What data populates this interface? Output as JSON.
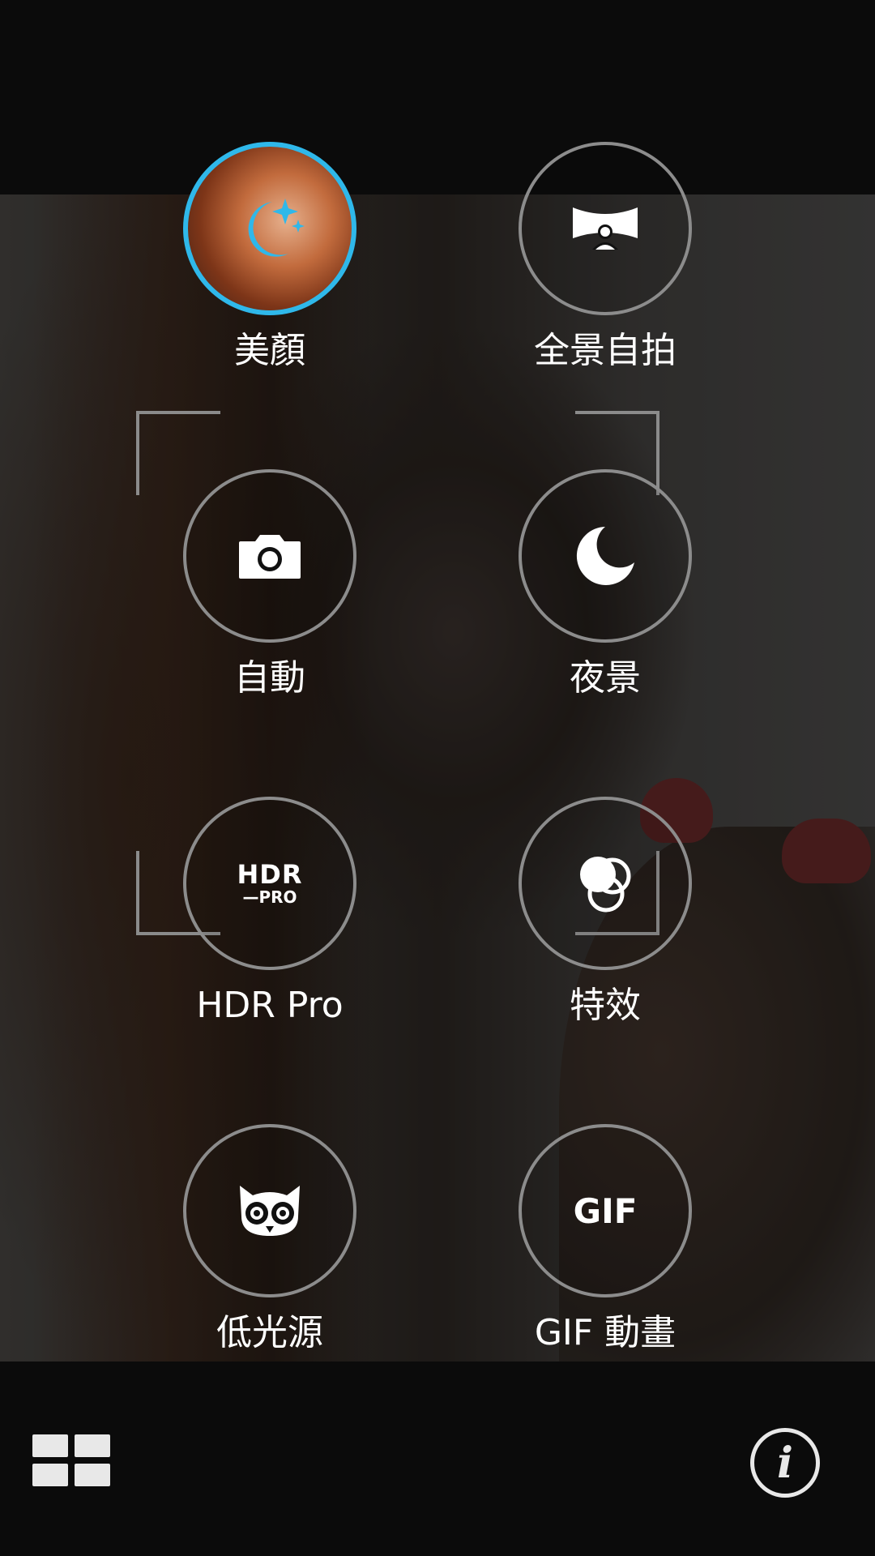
{
  "modes": [
    {
      "label": "美顏",
      "icon": "beauty-face-icon",
      "selected": true
    },
    {
      "label": "全景自拍",
      "icon": "panorama-selfie-icon",
      "selected": false
    },
    {
      "label": "自動",
      "icon": "camera-icon",
      "selected": false
    },
    {
      "label": "夜景",
      "icon": "moon-icon",
      "selected": false
    },
    {
      "label": "HDR Pro",
      "icon": "hdr-pro-icon",
      "icon_text_top": "HDR",
      "icon_text_bottom": "—PRO",
      "selected": false
    },
    {
      "label": "特效",
      "icon": "effects-circles-icon",
      "selected": false
    },
    {
      "label": "低光源",
      "icon": "owl-icon",
      "selected": false
    },
    {
      "label": "GIF 動畫",
      "icon": "gif-icon",
      "icon_text": "GIF",
      "selected": false
    }
  ],
  "bottom_bar": {
    "left_icon": "grid-modes-icon",
    "right_icon": "info-icon",
    "info_glyph": "i"
  },
  "colors": {
    "selected_ring": "#2fb8ea",
    "ring": "#8c8c8c",
    "background": "#0b0b0b"
  }
}
